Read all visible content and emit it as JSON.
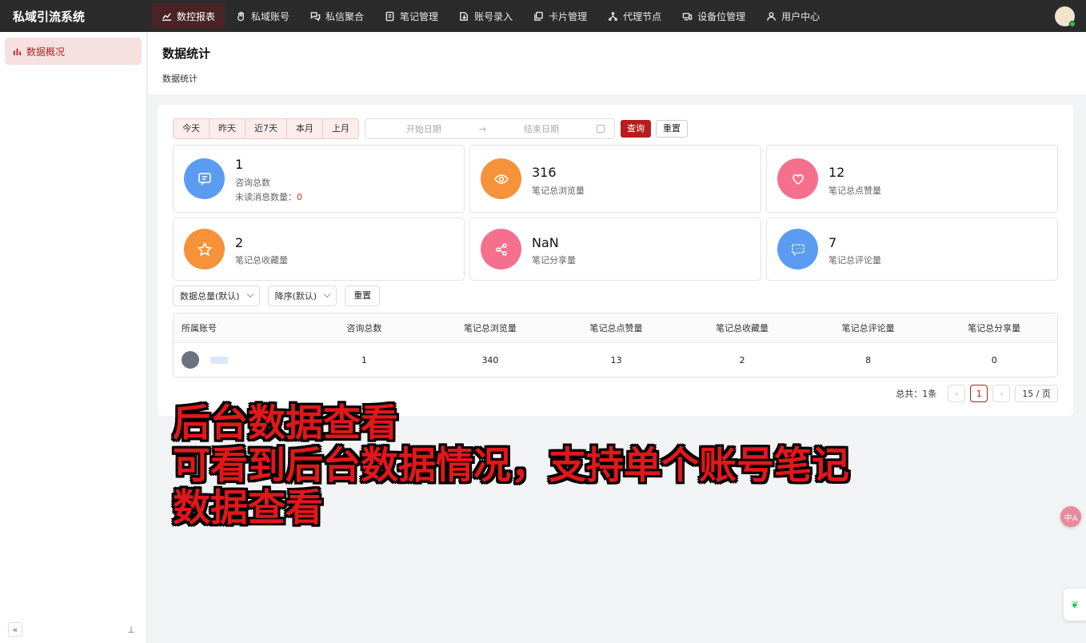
{
  "app": {
    "brand": "私域引流系统"
  },
  "nav": [
    {
      "label": "数控报表",
      "icon": "chart-icon",
      "active": true
    },
    {
      "label": "私域账号",
      "icon": "hand-icon"
    },
    {
      "label": "私信聚合",
      "icon": "chat-icon"
    },
    {
      "label": "笔记管理",
      "icon": "note-icon"
    },
    {
      "label": "账号录入",
      "icon": "import-icon"
    },
    {
      "label": "卡片管理",
      "icon": "card-icon"
    },
    {
      "label": "代理节点",
      "icon": "node-icon"
    },
    {
      "label": "设备位管理",
      "icon": "device-icon"
    },
    {
      "label": "用户中心",
      "icon": "user-icon"
    }
  ],
  "sidebar": {
    "items": [
      {
        "label": "数据概况",
        "icon": "bar-chart-icon"
      }
    ],
    "collapse_icon": "«",
    "pin_icon": "⊥"
  },
  "page": {
    "title": "数据统计",
    "breadcrumb": "数据统计"
  },
  "filters": {
    "ranges": [
      "今天",
      "昨天",
      "近7天",
      "本月",
      "上月"
    ],
    "start_placeholder": "开始日期",
    "end_placeholder": "结束日期",
    "query_label": "查询",
    "reset_label": "重置"
  },
  "stats": [
    {
      "value": "1",
      "label": "咨询总数",
      "extra_label": "未读消息数量：",
      "extra_value": "0",
      "color": "#5b9cf2",
      "icon": "message-icon"
    },
    {
      "value": "316",
      "label": "笔记总浏览量",
      "color": "#f6923a",
      "icon": "eye-icon"
    },
    {
      "value": "12",
      "label": "笔记总点赞量",
      "color": "#f5708d",
      "icon": "heart-icon"
    },
    {
      "value": "2",
      "label": "笔记总收藏量",
      "color": "#f6923a",
      "icon": "star-icon"
    },
    {
      "value": "NaN",
      "label": "笔记分享量",
      "color": "#f5708d",
      "icon": "share-icon"
    },
    {
      "value": "7",
      "label": "笔记总评论量",
      "color": "#5b9cf2",
      "icon": "comment-icon"
    }
  ],
  "sort": {
    "metric_value": "数据总量(默认)",
    "order_value": "降序(默认)",
    "reset_label": "重置"
  },
  "table": {
    "columns": [
      "所属账号",
      "咨询总数",
      "笔记总浏览量",
      "笔记总点赞量",
      "笔记总收藏量",
      "笔记总评论量",
      "笔记总分享量"
    ],
    "rows": [
      {
        "cells": [
          "1",
          "340",
          "13",
          "2",
          "8",
          "0"
        ]
      }
    ]
  },
  "pagination": {
    "total_text": "总共：1条",
    "current_page": "1",
    "page_size": "15 / 页"
  },
  "overlay": {
    "line1": "后台数据查看",
    "line2": "可看到后台数据情况，支持单个账号笔记",
    "line3": "数据查看"
  },
  "floating": {
    "translate_label": "中A"
  }
}
